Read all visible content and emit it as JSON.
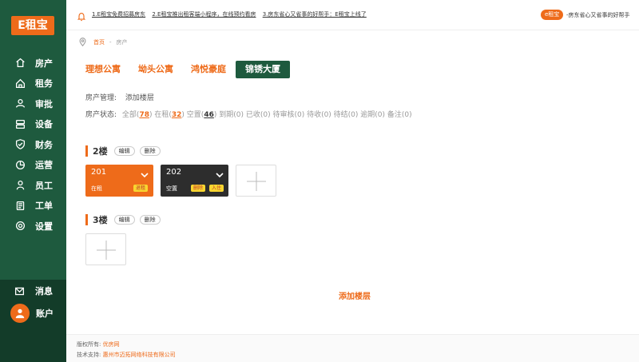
{
  "brand": {
    "logo": "E租宝"
  },
  "sidebar": {
    "items": [
      {
        "label": "房产",
        "icon": "home-icon"
      },
      {
        "label": "租务",
        "icon": "house-outline-icon"
      },
      {
        "label": "审批",
        "icon": "user-check-icon"
      },
      {
        "label": "设备",
        "icon": "device-icon"
      },
      {
        "label": "财务",
        "icon": "shield-check-icon"
      },
      {
        "label": "运营",
        "icon": "pie-chart-icon"
      },
      {
        "label": "员工",
        "icon": "person-icon"
      },
      {
        "label": "工单",
        "icon": "document-icon"
      },
      {
        "label": "设置",
        "icon": "gear-icon"
      }
    ],
    "message_label": "消息",
    "account_label": "账户"
  },
  "topbar": {
    "notices": [
      "1.E租宝免费招募房东",
      "2.E租宝推出租客端小程序，在线预约看房",
      "3.房东省心又省事的好帮手：E租宝上线了"
    ],
    "badge": "e租宝",
    "badge_text": "-房东省心又省事的好帮手"
  },
  "breadcrumb": {
    "home": "首页",
    "sep": "-",
    "current": "房产"
  },
  "tabs": [
    {
      "label": "理想公寓",
      "active": false
    },
    {
      "label": "坳头公寓",
      "active": false
    },
    {
      "label": "鸿悦豪庭",
      "active": false
    },
    {
      "label": "锦锈大厦",
      "active": true
    }
  ],
  "property_mgmt": {
    "label": "房产管理:",
    "action": "添加楼层"
  },
  "property_status": {
    "label": "房产状态:",
    "all_label": "全部(",
    "all_count": "78",
    "all_end": ")",
    "rented_label": "在租(",
    "rented_count": "32",
    "rented_end": ")",
    "vacant_label": "空置(",
    "vacant_count": "46",
    "vacant_end": ")",
    "rest": "到期(0) 已收(0) 待审核(0) 待收(0) 待结(0) 逾期(0) 备注(0)"
  },
  "floors": [
    {
      "title": "2楼",
      "edit": "编辑",
      "delete": "删除",
      "rooms": [
        {
          "number": "201",
          "status": "在租",
          "tags": [
            "退租"
          ]
        },
        {
          "number": "202",
          "status": "空置",
          "tags": [
            "删除",
            "入住"
          ]
        }
      ]
    },
    {
      "title": "3楼",
      "edit": "编辑",
      "delete": "删除",
      "rooms": []
    }
  ],
  "add_floor": "添加楼层",
  "footer": {
    "copyright_label": "版权所有:",
    "copyright_value": "优房网",
    "support_label": "技术支持:",
    "support_value": "惠州市迈拓网络科技有限公司"
  },
  "colors": {
    "primary": "#1e5a3e",
    "accent": "#ee6b1a",
    "vacant": "#2d2d2d",
    "tag": "#f8d630"
  }
}
